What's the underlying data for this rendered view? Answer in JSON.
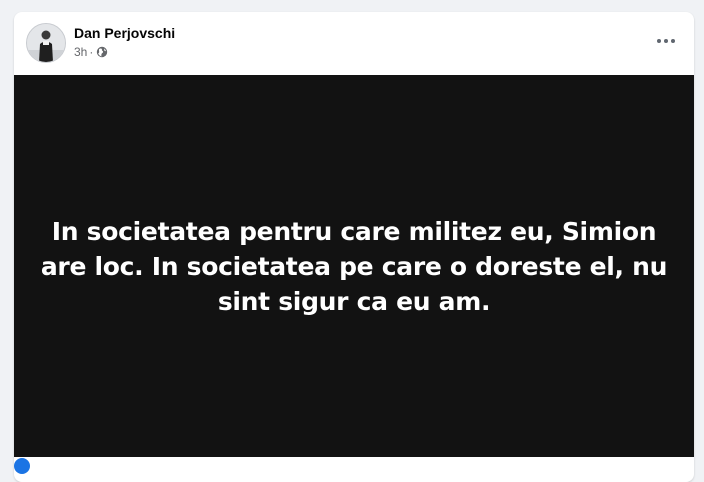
{
  "post": {
    "author": "Dan Perjovschi",
    "time": "3h",
    "separator": "·",
    "privacy_icon": "globe-icon",
    "more_icon": "more-options-icon",
    "image_text": "In societatea pentru care militez eu, Simion are loc. In societatea pe care o doreste el, nu sint sigur ca eu am."
  },
  "colors": {
    "page_background": "#f0f2f5",
    "card_background": "#ffffff",
    "image_background": "#121212",
    "image_text": "#ffffff",
    "meta_text": "#65676b"
  }
}
